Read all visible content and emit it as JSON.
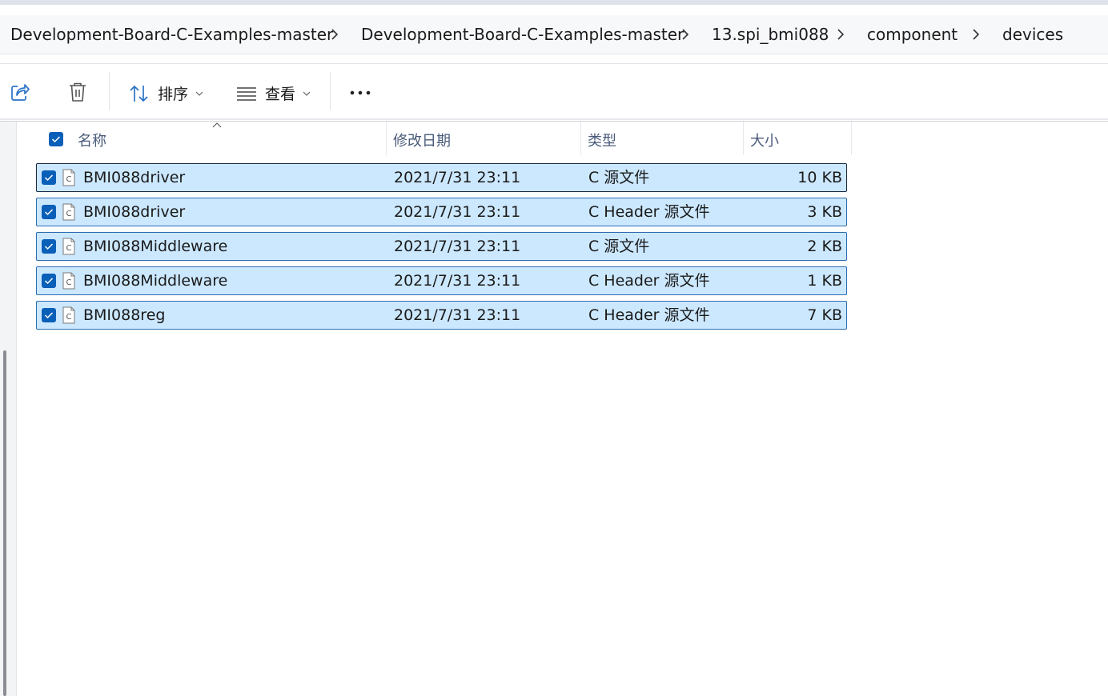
{
  "breadcrumb": [
    "Development-Board-C-Examples-master",
    "Development-Board-C-Examples-master",
    "13.spi_bmi088",
    "component",
    "devices"
  ],
  "toolbar": {
    "sort_label": "排序",
    "view_label": "查看"
  },
  "columns": {
    "name": "名称",
    "modified": "修改日期",
    "type": "类型",
    "size": "大小"
  },
  "files": [
    {
      "name": "BMI088driver",
      "modified": "2021/7/31 23:11",
      "type": "C 源文件",
      "size": "10 KB",
      "selected": true
    },
    {
      "name": "BMI088driver",
      "modified": "2021/7/31 23:11",
      "type": "C Header 源文件",
      "size": "3 KB",
      "selected": true
    },
    {
      "name": "BMI088Middleware",
      "modified": "2021/7/31 23:11",
      "type": "C 源文件",
      "size": "2 KB",
      "selected": true
    },
    {
      "name": "BMI088Middleware",
      "modified": "2021/7/31 23:11",
      "type": "C Header 源文件",
      "size": "1 KB",
      "selected": true
    },
    {
      "name": "BMI088reg",
      "modified": "2021/7/31 23:11",
      "type": "C Header 源文件",
      "size": "7 KB",
      "selected": true
    }
  ],
  "colors": {
    "selection_bg": "#cce8ff",
    "selection_border": "#2b6cb0",
    "checkbox_accent": "#0a5fb8",
    "header_text": "#4a5a7a"
  }
}
